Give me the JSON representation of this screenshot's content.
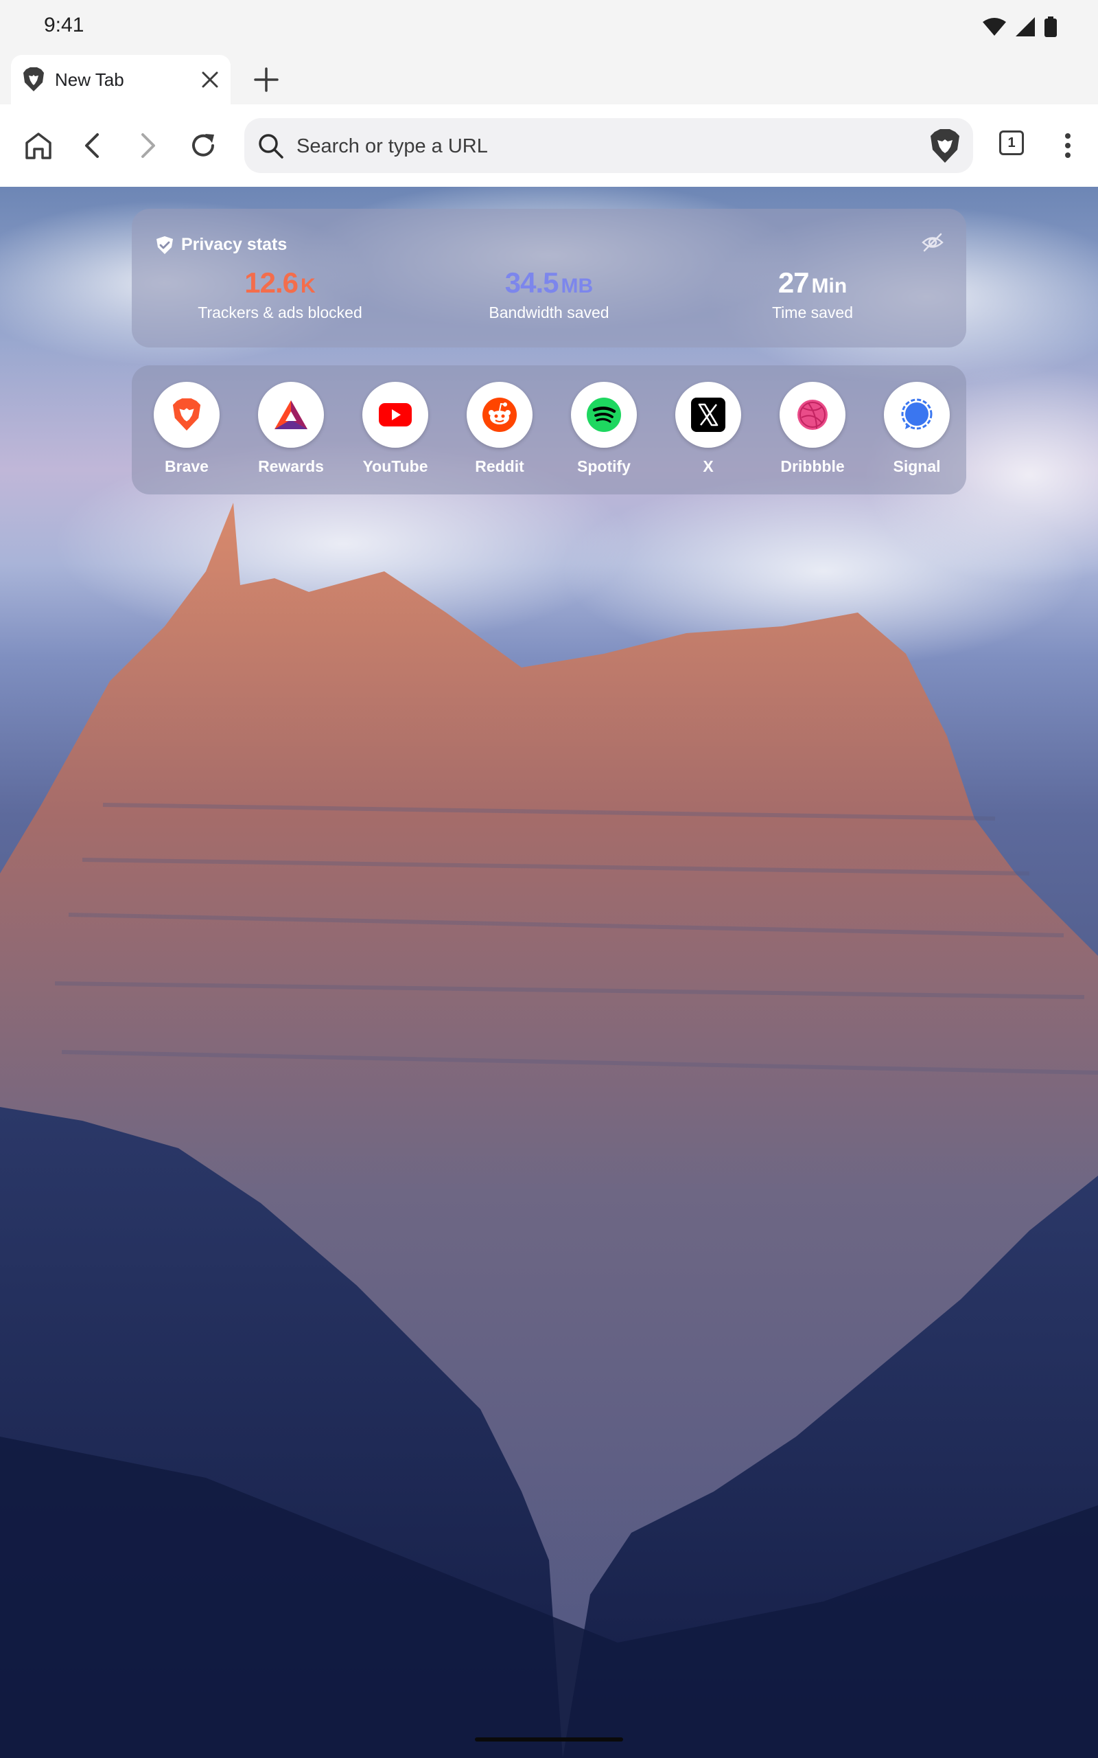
{
  "status": {
    "time": "9:41"
  },
  "tab": {
    "title": "New Tab"
  },
  "omnibox": {
    "placeholder": "Search or type a URL"
  },
  "toolbar": {
    "tab_count": "1"
  },
  "privacy_stats": {
    "title": "Privacy stats",
    "stats": [
      {
        "value": "12.6",
        "unit": "K",
        "label": "Trackers & ads blocked",
        "color": "#f46d4b"
      },
      {
        "value": "34.5",
        "unit": "MB",
        "label": "Bandwidth saved",
        "color": "#7c86ec"
      },
      {
        "value": "27",
        "unit": "Min",
        "label": "Time saved",
        "color": "#ffffff"
      }
    ]
  },
  "top_sites": [
    {
      "name": "Brave",
      "icon": "brave-lion-icon"
    },
    {
      "name": "Rewards",
      "icon": "bat-triangle-icon"
    },
    {
      "name": "YouTube",
      "icon": "youtube-icon"
    },
    {
      "name": "Reddit",
      "icon": "reddit-icon"
    },
    {
      "name": "Spotify",
      "icon": "spotify-icon"
    },
    {
      "name": "X",
      "icon": "x-icon"
    },
    {
      "name": "Dribbble",
      "icon": "dribbble-icon"
    },
    {
      "name": "Signal",
      "icon": "signal-icon"
    }
  ]
}
